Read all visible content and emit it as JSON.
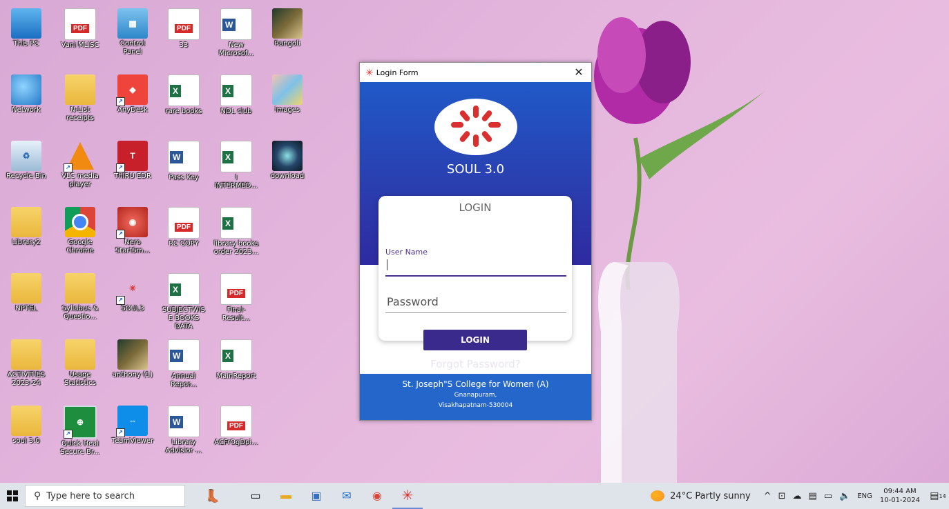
{
  "desktop": {
    "icons": [
      {
        "label": "This PC"
      },
      {
        "label": "Vani MLISC",
        "badge": "PDF"
      },
      {
        "label": "Control Panel"
      },
      {
        "label": "33",
        "badge": "PDF"
      },
      {
        "label": "New Microsof...",
        "badge": "W"
      },
      {
        "label": "Rangoli"
      },
      {
        "label": "Network"
      },
      {
        "label": "N-List receipts"
      },
      {
        "label": "AnyDesk"
      },
      {
        "label": "rare books",
        "badge": "X"
      },
      {
        "label": "NDL club",
        "badge": "X"
      },
      {
        "label": "images"
      },
      {
        "label": "Recycle Bin"
      },
      {
        "label": "VLC media player"
      },
      {
        "label": "ThIRU EDR"
      },
      {
        "label": "Pass Key",
        "badge": "W"
      },
      {
        "label": "I INTERMED...",
        "badge": "X"
      },
      {
        "label": "download"
      },
      {
        "label": "Library2"
      },
      {
        "label": "Google Chrome"
      },
      {
        "label": "Nero StartSm..."
      },
      {
        "label": "RC COPY",
        "badge": "PDF"
      },
      {
        "label": "library books order 2023...",
        "badge": "X"
      },
      {
        "label": "NPTEL"
      },
      {
        "label": "Syllabus & Questio..."
      },
      {
        "label": "SOUL3"
      },
      {
        "label": "SUBJECTWISE BOOKS DATA",
        "badge": "X"
      },
      {
        "label": "Final-Result...",
        "badge": "PDF"
      },
      {
        "label": "ACTIVITIES 2023-24"
      },
      {
        "label": "Usage Statistics"
      },
      {
        "label": "anthony (1)"
      },
      {
        "label": "Annual Repor...",
        "badge": "W"
      },
      {
        "label": "MainReport",
        "badge": "X"
      },
      {
        "label": "soul 3.0"
      },
      {
        "label": "Quick Heal Secure Br..."
      },
      {
        "label": "TeamViewer"
      },
      {
        "label": "Library Advisior ...",
        "badge": "W"
      },
      {
        "label": "ACFrOgDpi...",
        "badge": "PDF"
      }
    ]
  },
  "login_window": {
    "title": "Login Form",
    "close_glyph": "✕",
    "app_name": "SOUL 3.0",
    "card_title": "LOGIN",
    "username_label": "User Name",
    "username_value": "",
    "password_placeholder": "Password",
    "login_button": "LOGIN",
    "forgot_link": "Forgot Password?",
    "footer": {
      "college": "St. Joseph\"S College for Women (A)",
      "line2": "Gnanapuram,",
      "line3": "Visakhapatnam-530004"
    }
  },
  "taskbar": {
    "search_placeholder": "Type here to search",
    "weather_temp": "24°C",
    "weather_text": "Partly sunny",
    "language": "ENG",
    "time": "09:44 AM",
    "date": "10-01-2024",
    "notification_count": "14"
  },
  "colors": {
    "accent": "#3a2a8c",
    "header_blue": "#2466c9",
    "soul_red": "#d92f2f"
  }
}
